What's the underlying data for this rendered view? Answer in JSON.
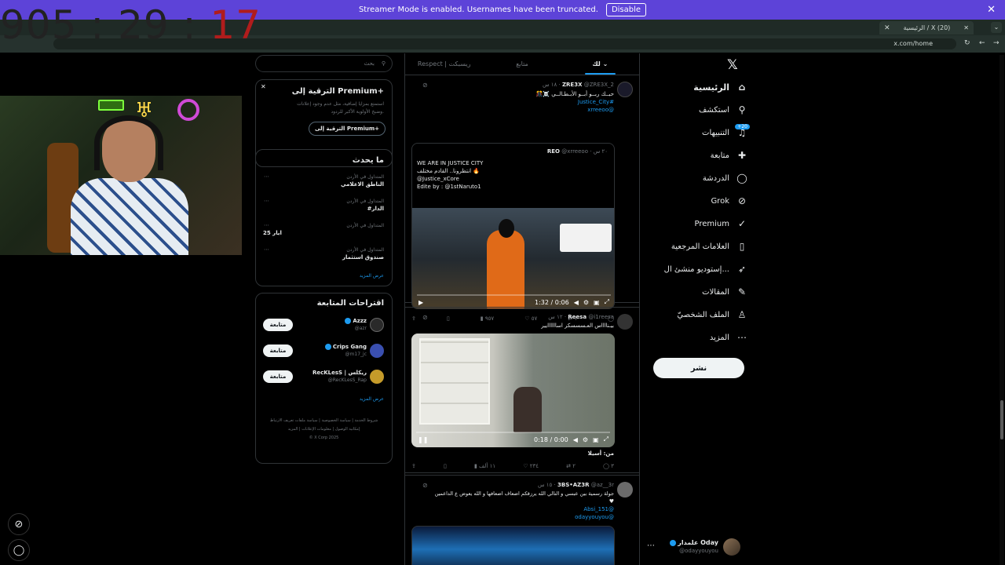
{
  "banner": {
    "text": "Streamer Mode is enabled. Usernames have been truncated.",
    "button": "Disable"
  },
  "browser": {
    "tab_title": "الرئيسية / X (20)",
    "url": "x.com/home"
  },
  "timer": {
    "main": "905 : 29 : ",
    "seconds": "17"
  },
  "nav": {
    "items": [
      {
        "label": "الرئيسية",
        "icon": "home-icon",
        "glyph": "⌂"
      },
      {
        "label": "استكشف",
        "icon": "search-icon",
        "glyph": "⚲"
      },
      {
        "label": "التنبيهات",
        "icon": "bell-icon",
        "glyph": "♫",
        "badge": "+20"
      },
      {
        "label": "متابعة",
        "icon": "follow-icon",
        "glyph": "✚"
      },
      {
        "label": "الدردشة",
        "icon": "chat-icon",
        "glyph": "◯"
      },
      {
        "label": "Grok",
        "icon": "grok-icon",
        "glyph": "⊘"
      },
      {
        "label": "Premium",
        "icon": "premium-icon",
        "glyph": "✓"
      },
      {
        "label": "العلامات المرجعية",
        "icon": "bookmark-icon",
        "glyph": "▯"
      },
      {
        "label": "إستوديو منشئ ال...",
        "icon": "rocket-icon",
        "glyph": "➶"
      },
      {
        "label": "المقالات",
        "icon": "article-icon",
        "glyph": "✎"
      },
      {
        "label": "الملف الشخصيّ",
        "icon": "profile-icon",
        "glyph": "♙"
      },
      {
        "label": "المزيد",
        "icon": "more-icon",
        "glyph": "⋯"
      }
    ],
    "post_button": "نشر",
    "account": {
      "name": "علمدار Oday",
      "handle": "@odayyouyou"
    }
  },
  "feed": {
    "tabs": [
      "لك",
      "متابع",
      "Respect | ريسبكت"
    ],
    "tweets": [
      {
        "name": "ZRE3X",
        "handle": "@ZRE3X_2",
        "time": "١٨ س",
        "text": "حبــك ربــو أبــو الأبـطـالــي ☠️🎊",
        "tag": "#Justice_City",
        "link": "@xrreeoo",
        "quote": {
          "name": "REO",
          "handle": "@xrreeoo",
          "time": "٢٠ س",
          "lines": [
            "WE ARE IN JUSTICE CITY",
            "انتظرونا.. القادم مختلف 🔥",
            "@Justice_xCore",
            "Edite by : @1stNaruto1"
          ],
          "video_time": "1:32 / 0:06"
        },
        "actions": {
          "reply": "",
          "retweet": "١",
          "like": "٥٧",
          "views": "٩٥٧"
        }
      },
      {
        "name": "Reesa",
        "handle": "@i1reesa",
        "time": "١٢ س",
        "text": "بيـنااااس العـسسسكر اساااااايير",
        "video_time": "0:18 / 0:00",
        "caption": "من: أسيلا",
        "actions": {
          "reply": "٣",
          "retweet": "٢",
          "like": "٢٣٤",
          "views": "١١ ألف"
        }
      },
      {
        "name": "3BS•AZ3R",
        "handle": "@az__3r",
        "time": "١٥ س",
        "text": "جولة رسمية بين عبسي و التالي الله يرزقكم اضعاف اضعافها و الله يعوض ع الداعمين",
        "heart": "♥",
        "links": [
          "@Absi_151",
          "@odayyouyou"
        ]
      }
    ]
  },
  "sidebar": {
    "search_placeholder": "بحث",
    "premium": {
      "title": "الترقية إلى Premium+",
      "body_1": "استمتع بمزايا إضافية، مثل عدم وجود إعلانات",
      "body_2": "وضبخ الأولوية الأكبر للردود.",
      "button": "الترقية إلى Premium+"
    },
    "trends": {
      "title": "ما يحدث",
      "items": [
        {
          "context": "المتداول في الأردن",
          "name": "الناطق الاعلامي"
        },
        {
          "context": "المتداول في الأردن",
          "name": "#الدار"
        },
        {
          "context": "المتداول في الأردن",
          "name": "ايار 25"
        },
        {
          "context": "المتداول في الأردن",
          "name": "صندوق استثمار"
        }
      ],
      "more": "عرض المزيد"
    },
    "follow": {
      "title": "اقتراحات المتابعة",
      "items": [
        {
          "name": "Azzz",
          "handle": "@azr",
          "button": "متابعة"
        },
        {
          "name": "Crips Gang",
          "handle": "@m17_jc",
          "button": "متابعة"
        },
        {
          "name": "RecKLesS | ريكلس",
          "handle": "@RecKLesS_Rap",
          "button": "متابعة"
        }
      ],
      "more": "عرض المزيد"
    },
    "footer": [
      "شروط الخدمة",
      "سياسة الخصوصية",
      "سياسة ملفات تعريف الارتباط",
      "إمكانية الوصول",
      "معلومات الإعلانات",
      "المزيد",
      "© X Corp 2025"
    ]
  },
  "colors": {
    "banner": "#5d43d8",
    "accent": "#1d9bf0",
    "timer_red": "#b01c1c"
  }
}
